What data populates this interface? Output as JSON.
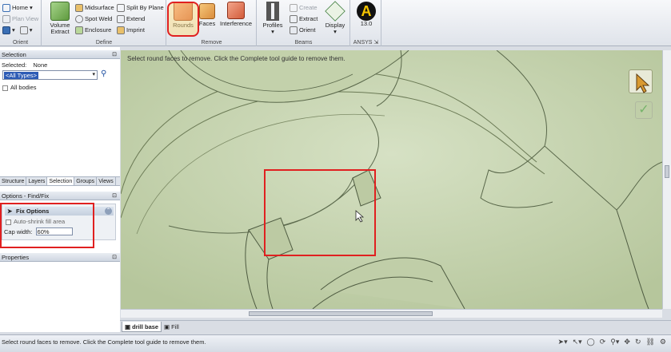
{
  "ribbon": {
    "orient": {
      "label": "Orient",
      "home": "Home",
      "plan_view": "Plan View"
    },
    "define": {
      "label": "Define",
      "volume_extract": "Volume Extract",
      "midsurface": "Midsurface",
      "spot_weld": "Spot Weld",
      "enclosure": "Enclosure",
      "split_by_plane": "Split By Plane",
      "extend": "Extend",
      "imprint": "Imprint"
    },
    "remove": {
      "label": "Remove",
      "rounds": "Rounds",
      "faces": "Faces",
      "interference": "Interference"
    },
    "beams": {
      "label": "Beams",
      "profiles": "Profiles",
      "create": "Create",
      "extract": "Extract",
      "orient": "Orient",
      "display": "Display"
    },
    "ansys": {
      "label": "ANSYS",
      "version": "13.0",
      "logo": "A"
    }
  },
  "selection_panel": {
    "title": "Selection",
    "selected_label": "Selected:",
    "selected_value": "None",
    "filter_value": "<All Types>",
    "all_bodies": "All bodies"
  },
  "panel_tabs": [
    "Structure",
    "Layers",
    "Selection",
    "Groups",
    "Views"
  ],
  "options_panel": {
    "title": "Options - Find/Fix",
    "fix_options_title": "Fix Options",
    "auto_shrink": "Auto-shrink fill area",
    "cap_width_label": "Cap width:",
    "cap_width_value": "60%"
  },
  "properties_panel": {
    "title": "Properties"
  },
  "viewport": {
    "hint": "Select round faces to remove. Click the Complete tool guide to remove them."
  },
  "doc_tabs": {
    "tab1": "drill base",
    "tab2": "Fill"
  },
  "status": {
    "text": "Select round faces to remove. Click the Complete tool guide to remove them."
  },
  "colors": {
    "model": "#c7d4b0",
    "highlight": "#e02020"
  }
}
